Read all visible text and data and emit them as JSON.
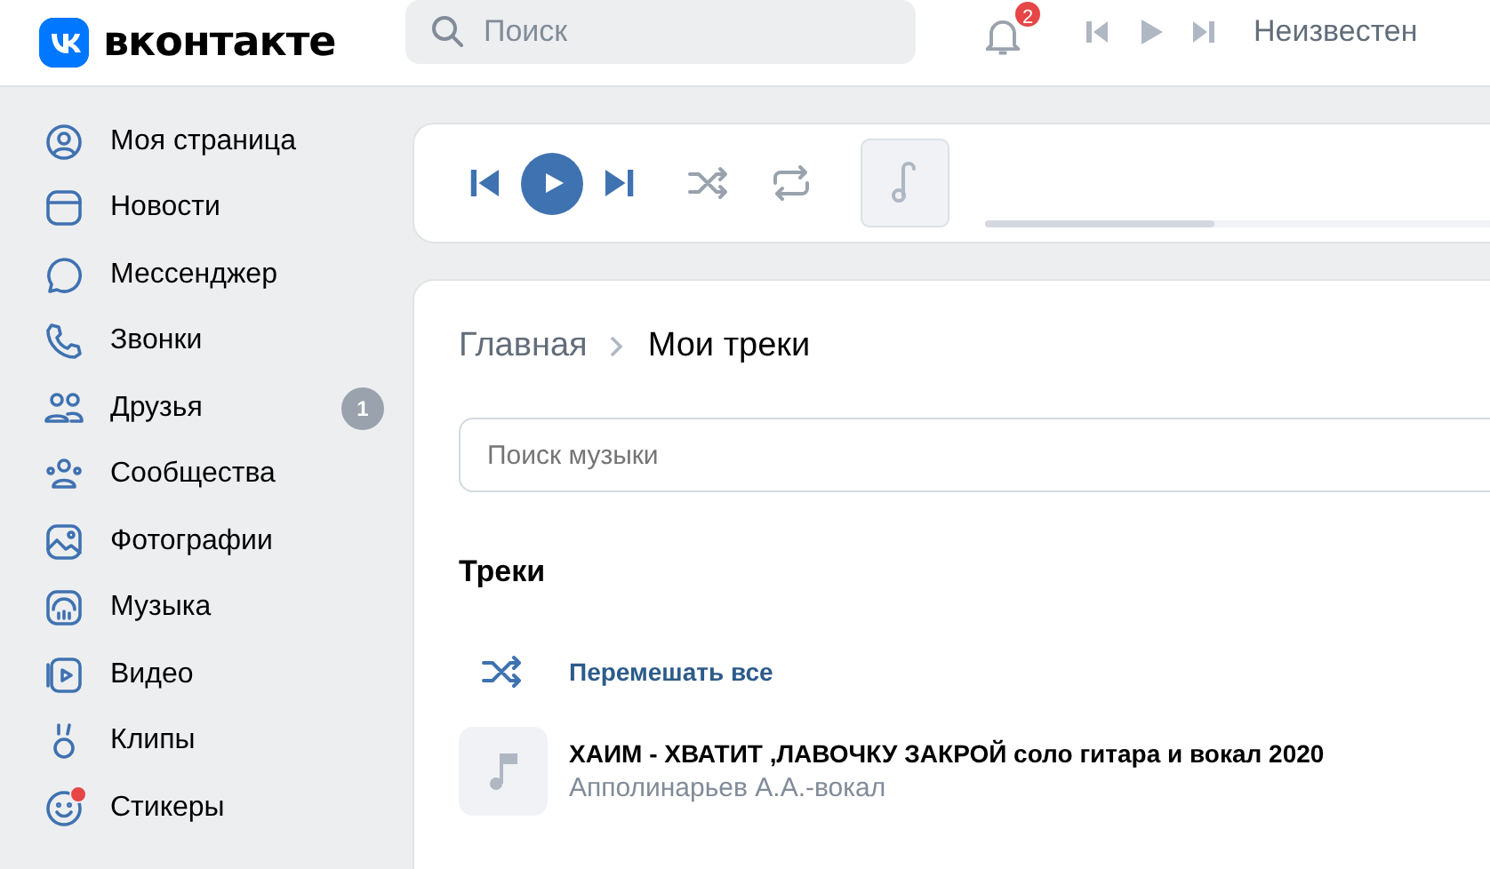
{
  "header": {
    "logo": "вконтакте",
    "search": {
      "placeholder": "Поиск"
    },
    "notifications": "2",
    "now_playing": "Неизвестен"
  },
  "sidebar": {
    "items": [
      {
        "label": "Моя страница",
        "new": false
      },
      {
        "label": "Новости",
        "new": false
      },
      {
        "label": "Мессенджер",
        "new": false
      },
      {
        "label": "Звонки",
        "new": false
      },
      {
        "label": "Друзья",
        "badge": "1",
        "new": false
      },
      {
        "label": "Сообщества",
        "new": false
      },
      {
        "label": "Фотографии",
        "new": false
      },
      {
        "label": "Музыка",
        "new": false
      },
      {
        "label": "Видео",
        "new": false
      },
      {
        "label": "Клипы",
        "new": false
      },
      {
        "label": "Стикеры",
        "new": true
      }
    ]
  },
  "player": {
    "playing": false,
    "level": 0.4
  },
  "content": {
    "breadcrumbs": [
      "Главная",
      "Мои треки"
    ],
    "search": {
      "placeholder": "Поиск музыки"
    },
    "section_title": "Треки",
    "shuffle_all": "Перемешать все",
    "tracks": [
      {
        "title": "ХАИМ - ХВАТИТ ,ЛАВОЧКУ ЗАКРОЙ соло гитара и вокал 2020",
        "artist": "Апполинарьев А.А.-вокал"
      }
    ]
  }
}
